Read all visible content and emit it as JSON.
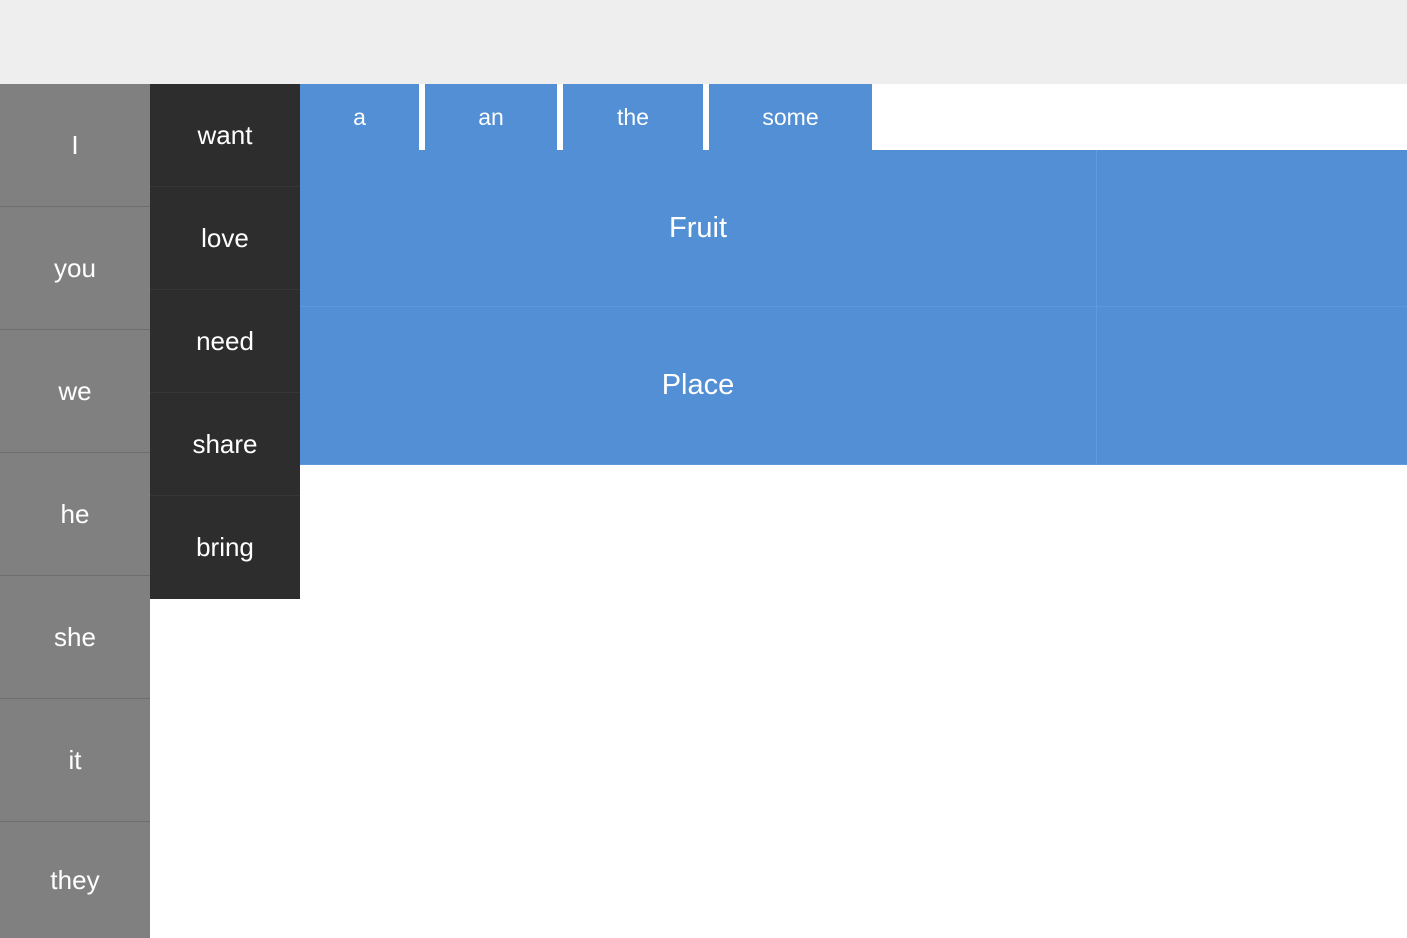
{
  "pronouns": [
    "I",
    "you",
    "we",
    "he",
    "she",
    "it",
    "they"
  ],
  "verbs": [
    "want",
    "love",
    "need",
    "share",
    "bring"
  ],
  "articles": [
    "a",
    "an",
    "the",
    "some"
  ],
  "categories": [
    "Fruit",
    "Place"
  ],
  "colors": {
    "topbar": "#eeeeee",
    "pronoun_bg": "#808080",
    "verb_bg": "#2d2d2d",
    "accent_blue": "#538fd4",
    "text": "#ffffff"
  }
}
